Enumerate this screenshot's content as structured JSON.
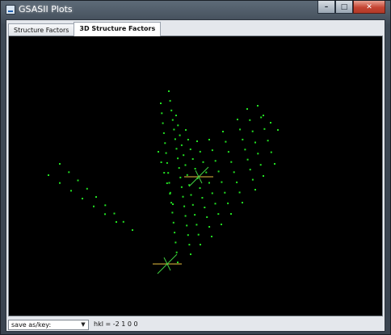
{
  "window": {
    "title": "GSASII Plots",
    "controls": {
      "minimize": "–",
      "maximize": "□",
      "close": "✕"
    }
  },
  "tabs": [
    {
      "label": "Structure Factors",
      "active": false
    },
    {
      "label": "3D Structure Factors",
      "active": true
    }
  ],
  "plot": {
    "background": "#000000",
    "point_color": "#22e022",
    "marker_color": "#e8c040",
    "axis_color": "#40d040"
  },
  "statusbar": {
    "save_select_value": "save as/key:",
    "status_text": "hkl = -2 1 0 0"
  }
}
